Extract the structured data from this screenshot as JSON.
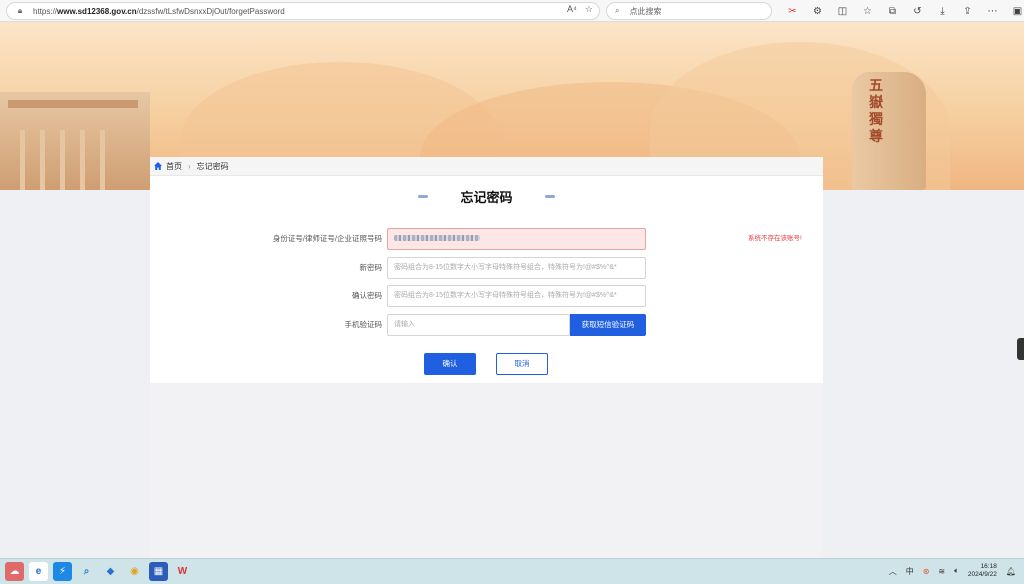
{
  "browser": {
    "url_prefix": "https://",
    "url_host": "www.sd12368.gov.cn",
    "url_path": "/dzssfw/tLsfwDsnxxDjOut/forgetPassword",
    "search_placeholder": "点此搜索",
    "lock_icon": "lock-icon",
    "read_aloud_label": "A⁴"
  },
  "breadcrumb": {
    "home": "首页",
    "current": "忘记密码"
  },
  "banner": {
    "stone_text": "五嶽獨尊"
  },
  "form": {
    "title": "忘记密码",
    "id_label": "身份证号/律师证号/企业证照号码",
    "id_error": "系统不存在该账号!",
    "new_pw_label": "新密码",
    "new_pw_placeholder": "密码组合为8-15位数字大小写字母特殊符号组合，特殊符号为!@#$%^&*",
    "confirm_pw_label": "确认密码",
    "confirm_pw_placeholder": "密码组合为8-15位数字大小写字母特殊符号组合，特殊符号为!@#$%^&*",
    "phone_code_label": "手机验证码",
    "phone_code_placeholder": "请输入",
    "sms_button": "获取短信验证码",
    "confirm_button": "确认",
    "cancel_button": "取消"
  },
  "taskbar": {
    "time": "16:18",
    "date": "2024/9/22"
  },
  "colors": {
    "primary": "#1f5fe0",
    "error": "#e53b3b",
    "error_bg": "#fde6e6"
  }
}
